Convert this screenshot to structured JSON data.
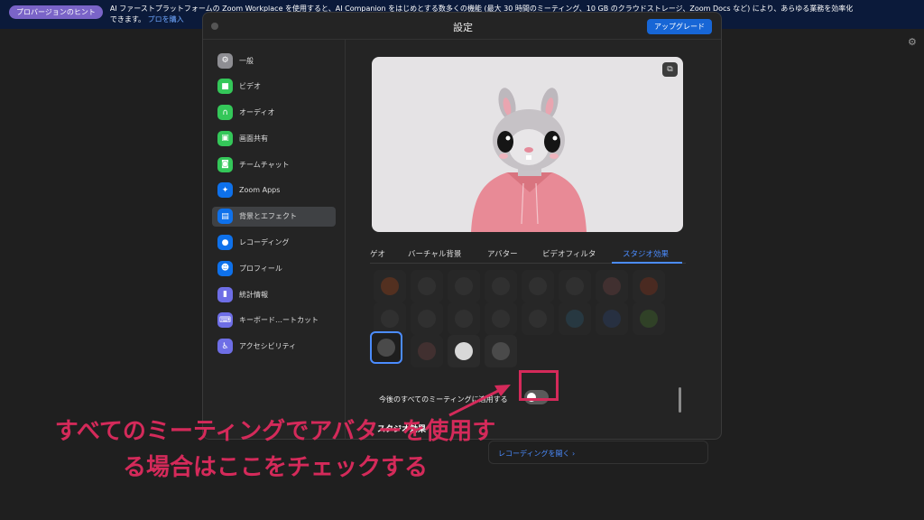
{
  "banner": {
    "badge": "プロバージョンのヒント",
    "line1": "AI ファーストプラットフォームの Zoom Workplace を使用すると、AI Companion をはじめとする数多くの機能 (最大 30 時間のミーティング、10 GB のクラウドストレージ、Zoom Docs など) により、あらゆる業務を効率化",
    "line2": "できます。",
    "link": "プロを購入"
  },
  "window": {
    "title": "設定",
    "upgrade_label": "アップグレード"
  },
  "sidebar": {
    "items": [
      {
        "label": "一般",
        "icon": "gear-icon",
        "color": "#8e8e93"
      },
      {
        "label": "ビデオ",
        "icon": "video-camera-icon",
        "color": "#34c759"
      },
      {
        "label": "オーディオ",
        "icon": "headphones-icon",
        "color": "#34c759"
      },
      {
        "label": "画面共有",
        "icon": "screen-share-icon",
        "color": "#34c759"
      },
      {
        "label": "チームチャット",
        "icon": "chat-icon",
        "color": "#34c759"
      },
      {
        "label": "Zoom Apps",
        "icon": "apps-icon",
        "color": "#0e71eb"
      },
      {
        "label": "背景とエフェクト",
        "icon": "background-icon",
        "color": "#0e71eb"
      },
      {
        "label": "レコーディング",
        "icon": "record-icon",
        "color": "#0e71eb"
      },
      {
        "label": "プロフィール",
        "icon": "profile-icon",
        "color": "#0e71eb"
      },
      {
        "label": "統計情報",
        "icon": "statistics-icon",
        "color": "#6e6ee6"
      },
      {
        "label": "キーボード…ートカット",
        "icon": "keyboard-icon",
        "color": "#6e6ee6"
      },
      {
        "label": "アクセシビリティ",
        "icon": "accessibility-icon",
        "color": "#6e6ee6"
      }
    ]
  },
  "tabs": {
    "items": [
      "ビデオ",
      "バーチャル背景",
      "アバター",
      "ビデオフィルタ",
      "スタジオ効果"
    ],
    "partial_first": "ゲオ"
  },
  "apply_all_label": "今後のすべてのミーティングに適用する",
  "studio_heading": "スタジオ効果",
  "recording_link": "レコーディングを開く ›",
  "annotation": {
    "line1": "すべてのミーティングでアバターを使用す",
    "line2": "る場合はここをチェックする"
  },
  "colors": {
    "accent": "#4b8cff",
    "annotation": "#d42a5a",
    "banner": "#0b1a3a"
  }
}
